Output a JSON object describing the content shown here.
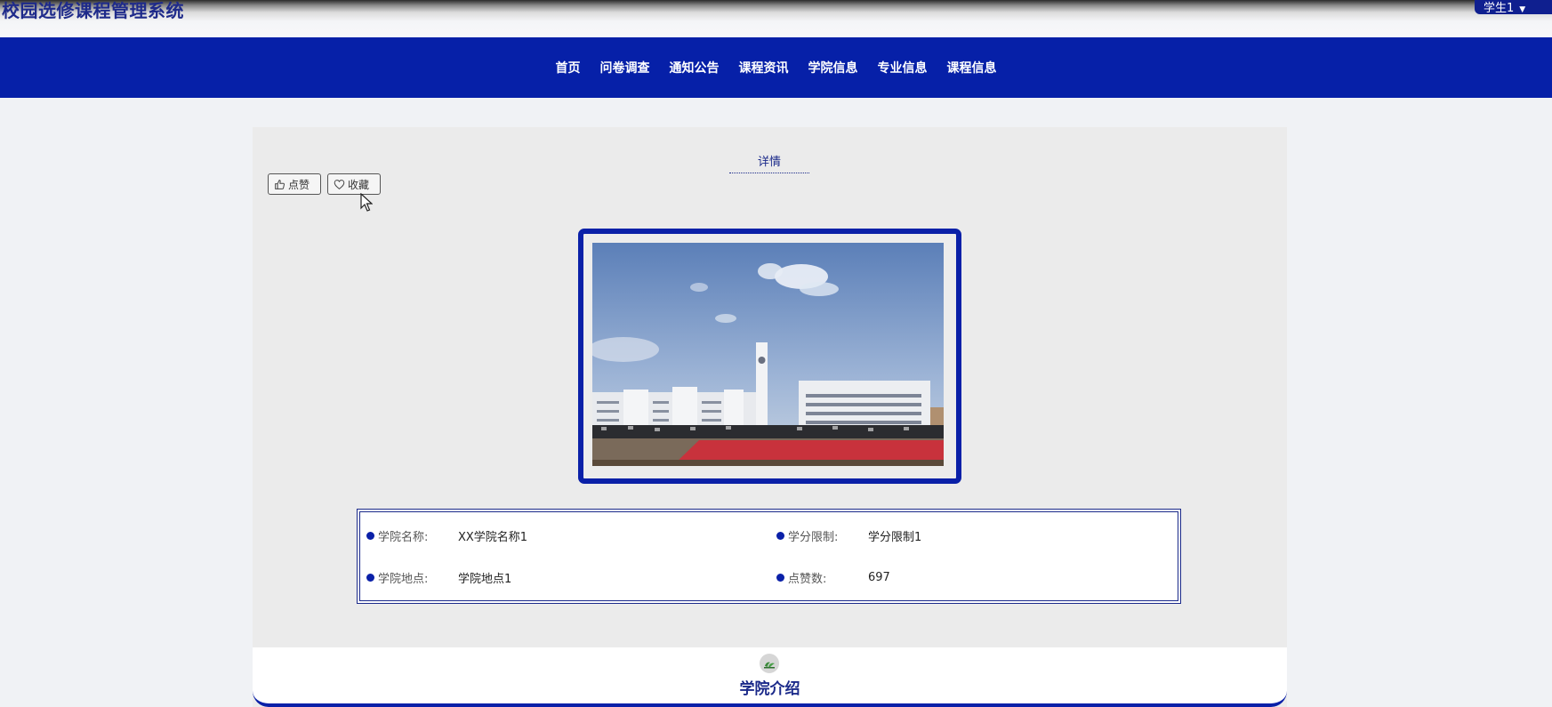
{
  "header": {
    "site_title": "校园选修课程管理系统",
    "user_label": "学生1",
    "caret_icon": "caret-down-icon"
  },
  "nav": {
    "items": [
      {
        "label": "首页"
      },
      {
        "label": "问卷调查"
      },
      {
        "label": "通知公告"
      },
      {
        "label": "课程资讯"
      },
      {
        "label": "学院信息"
      },
      {
        "label": "专业信息"
      },
      {
        "label": "课程信息"
      }
    ]
  },
  "detail": {
    "tab_title": "详情",
    "like_label": "点赞",
    "like_icon": "thumbs-up-icon",
    "favorite_label": "收藏",
    "favorite_icon": "heart-icon",
    "fields": [
      {
        "label": "学院名称:",
        "value": "XX学院名称1"
      },
      {
        "label": "学分限制:",
        "value": "学分限制1"
      },
      {
        "label": "学院地点:",
        "value": "学院地点1"
      },
      {
        "label": "点赞数:",
        "value": "697"
      }
    ]
  },
  "intro": {
    "title": "学院介绍",
    "icon": "plant-icon"
  },
  "colors": {
    "primary": "#0620a8",
    "title_blue": "#1b2a8a",
    "panel_bg": "#ebebeb"
  }
}
